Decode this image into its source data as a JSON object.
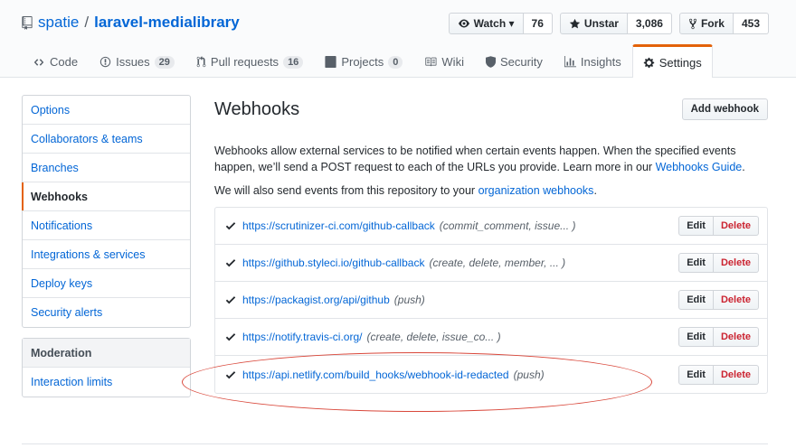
{
  "repo": {
    "owner": "spatie",
    "slash": "/",
    "name": "laravel-medialibrary"
  },
  "actions": [
    {
      "label": "Watch ▾",
      "icon": "eye-icon",
      "count": "76"
    },
    {
      "label": "Unstar",
      "icon": "star-icon",
      "count": "3,086"
    },
    {
      "label": "Fork",
      "icon": "fork-icon",
      "count": "453"
    }
  ],
  "tabs": [
    {
      "label": "Code",
      "icon": "code-icon",
      "count": ""
    },
    {
      "label": "Issues",
      "icon": "issue-icon",
      "count": "29"
    },
    {
      "label": "Pull requests",
      "icon": "pull-request-icon",
      "count": "16"
    },
    {
      "label": "Projects",
      "icon": "project-icon",
      "count": "0"
    },
    {
      "label": "Wiki",
      "icon": "book-icon",
      "count": ""
    },
    {
      "label": "Security",
      "icon": "shield-icon",
      "count": ""
    },
    {
      "label": "Insights",
      "icon": "graph-icon",
      "count": ""
    },
    {
      "label": "Settings",
      "icon": "gear-icon",
      "count": "",
      "selected": true
    }
  ],
  "sidebar": {
    "items": [
      {
        "label": "Options"
      },
      {
        "label": "Collaborators & teams"
      },
      {
        "label": "Branches"
      },
      {
        "label": "Webhooks",
        "selected": true
      },
      {
        "label": "Notifications"
      },
      {
        "label": "Integrations & services"
      },
      {
        "label": "Deploy keys"
      },
      {
        "label": "Security alerts"
      }
    ],
    "moderation_heading": "Moderation",
    "moderation_items": [
      {
        "label": "Interaction limits"
      }
    ]
  },
  "main": {
    "title": "Webhooks",
    "add_button": "Add webhook",
    "description_text": "Webhooks allow external services to be notified when certain events happen. When the specified events happen, we’ll send a POST request to each of the URLs you provide. Learn more in our ",
    "description_link": "Webhooks Guide",
    "description_end": ".",
    "org_text": "We will also send events from this repository to your ",
    "org_link": "organization webhooks",
    "org_end": ".",
    "edit_label": "Edit",
    "delete_label": "Delete",
    "hooks": [
      {
        "url": "https://scrutinizer-ci.com/github-callback",
        "events": "(commit_comment, issue... )"
      },
      {
        "url": "https://github.styleci.io/github-callback",
        "events": "(create, delete, member, ... )"
      },
      {
        "url": "https://packagist.org/api/github",
        "events": "(push)"
      },
      {
        "url": "https://notify.travis-ci.org/",
        "events": "(create, delete, issue_co... )"
      },
      {
        "url": "https://api.netlify.com/build_hooks/webhook-id-redacted",
        "events": "(push)"
      }
    ]
  },
  "colors": {
    "link": "#0366d6",
    "accent_orange": "#e36209",
    "danger": "#cb2431",
    "annotation_red": "#d9473a"
  }
}
